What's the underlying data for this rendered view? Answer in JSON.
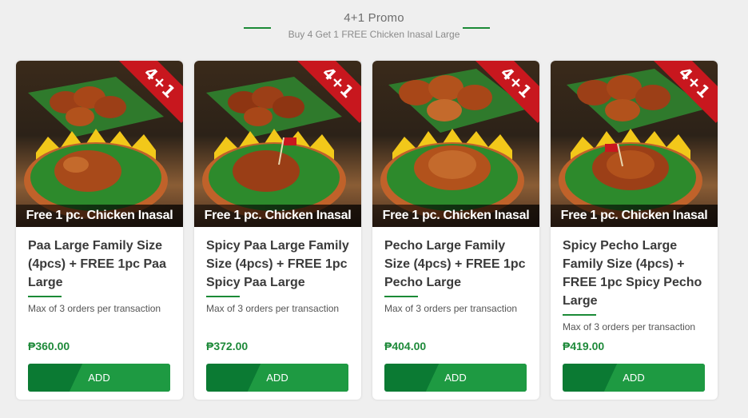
{
  "promo": {
    "title": "4+1 Promo",
    "subtitle": "Buy 4 Get 1 FREE Chicken Inasal Large"
  },
  "colors": {
    "accent": "#1b8a36",
    "price": "#1e8a3a",
    "ribbon": "#c8171e",
    "button": "#0b7a33"
  },
  "cards": [
    {
      "badge": "4+1",
      "image_caption": "Free 1 pc. Chicken Inasal",
      "name": "Paa Large Family Size (4pcs) + FREE 1pc Paa Large",
      "limit": "Max of 3 orders per transaction",
      "price": "₱360.00",
      "button": "ADD"
    },
    {
      "badge": "4+1",
      "image_caption": "Free 1 pc. Chicken Inasal",
      "name": "Spicy Paa Large Family Size (4pcs) + FREE 1pc Spicy Paa Large",
      "limit": "Max of 3 orders per transaction",
      "price": "₱372.00",
      "button": "ADD"
    },
    {
      "badge": "4+1",
      "image_caption": "Free 1 pc. Chicken Inasal",
      "name": "Pecho Large Family Size (4pcs) + FREE 1pc Pecho Large",
      "limit": "Max of 3 orders per transaction",
      "price": "₱404.00",
      "button": "ADD"
    },
    {
      "badge": "4+1",
      "image_caption": "Free 1 pc. Chicken Inasal",
      "name": "Spicy Pecho Large Family Size (4pcs) + FREE 1pc Spicy Pecho Large",
      "limit": "Max of 3 orders per transaction",
      "price": "₱419.00",
      "button": "ADD"
    }
  ]
}
